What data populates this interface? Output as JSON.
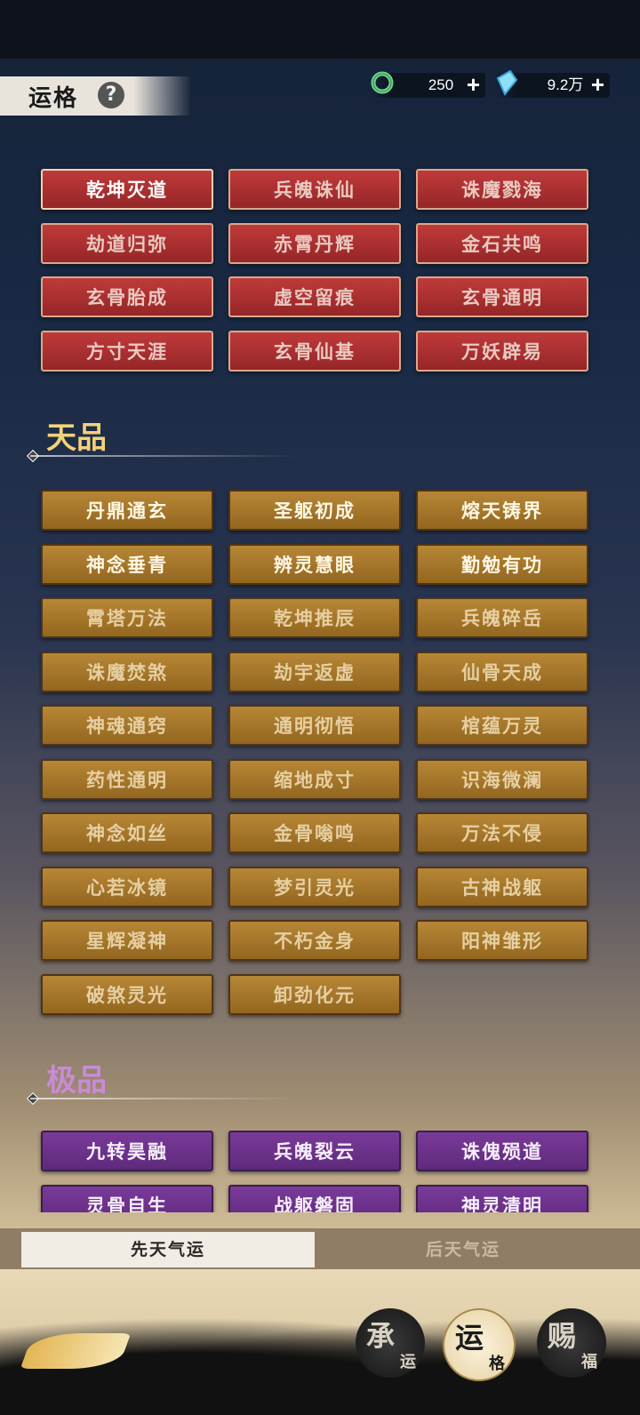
{
  "header": {
    "title": "运格",
    "help_icon": "?",
    "jade": {
      "icon": "jade-ring-icon",
      "value": "250",
      "add": "+"
    },
    "crystal": {
      "icon": "crystal-icon",
      "value": "9.2万",
      "add": "+"
    }
  },
  "red_items": [
    "乾坤灭道",
    "兵魄诛仙",
    "诛魔戮海",
    "劫道归弥",
    "赤霄丹辉",
    "金石共鸣",
    "玄骨胎成",
    "虚空留痕",
    "玄骨通明",
    "方寸天涯",
    "玄骨仙基",
    "万妖辟易"
  ],
  "tianpin": {
    "label": "天品",
    "items": [
      "丹鼎通玄",
      "圣躯初成",
      "熔天铸界",
      "神念垂青",
      "辨灵慧眼",
      "勤勉有功",
      "霄塔万法",
      "乾坤推辰",
      "兵魄碎岳",
      "诛魔焚煞",
      "劫宇返虚",
      "仙骨天成",
      "神魂通窍",
      "通明彻悟",
      "棺蕴万灵",
      "药性通明",
      "缩地成寸",
      "识海微澜",
      "神念如丝",
      "金骨嗡鸣",
      "万法不侵",
      "心若冰镜",
      "梦引灵光",
      "古神战躯",
      "星辉凝神",
      "不朽金身",
      "阳神雏形",
      "破煞灵光",
      "卸劲化元"
    ]
  },
  "jipin": {
    "label": "极品",
    "items": [
      "九转昊融",
      "兵魄裂云",
      "诛傀殒道",
      "灵骨自生",
      "战躯磐固",
      "神灵清明"
    ]
  },
  "tabs": {
    "active": "先天气运",
    "inactive": "后天气运"
  },
  "nav": [
    {
      "big": "承",
      "small": "运"
    },
    {
      "big": "运",
      "small": "格"
    },
    {
      "big": "赐",
      "small": "福"
    }
  ]
}
